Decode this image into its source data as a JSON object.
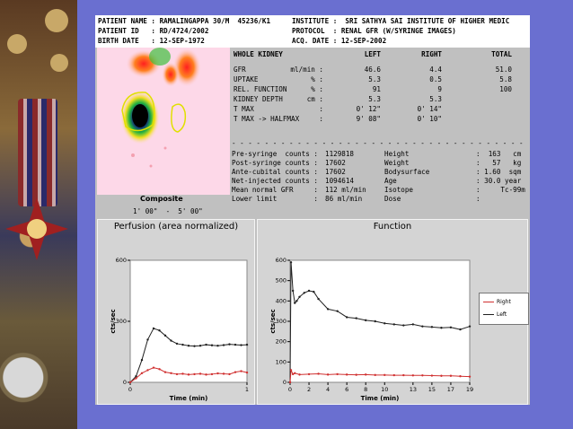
{
  "header": {
    "patient_name": "PATIENT NAME : RAMALINGAPPA 30/M  45236/K1",
    "patient_id": "PATIENT ID   : RD/4724/2002",
    "birth_date": "BIRTH DATE   : 12-SEP-1972",
    "institute": "INSTITUTE :  SRI SATHYA SAI INSTITUTE OF HIGHER MEDIC",
    "protocol": "PROTOCOL  : RENAL GFR (W/SYRINGE IMAGES)",
    "acq_date": "ACQ. DATE : 12-SEP-2002"
  },
  "composite": {
    "title": "Composite",
    "time_range": "1' 00\"  -  5' 00\""
  },
  "kidney_table": {
    "headers": [
      "WHOLE KIDNEY",
      "LEFT",
      "RIGHT",
      "TOTAL"
    ],
    "rows": [
      {
        "label": "GFR",
        "unit": "ml/min :",
        "left": "46.6",
        "right": "4.4",
        "total": "51.0"
      },
      {
        "label": "UPTAKE",
        "unit": "% :",
        "left": "5.3",
        "right": "0.5",
        "total": "5.8"
      },
      {
        "label": "REL. FUNCTION",
        "unit": "% :",
        "left": "91",
        "right": "9",
        "total": "100"
      },
      {
        "label": "KIDNEY DEPTH",
        "unit": "cm :",
        "left": "5.3",
        "right": "5.3",
        "total": ""
      },
      {
        "label": "T MAX",
        "unit": ":",
        "left": "0' 12\"",
        "right": "0' 14\"",
        "total": ""
      },
      {
        "label": "T MAX -> HALFMAX",
        "unit": ":",
        "left": "9' 08\"",
        "right": "0' 10\"",
        "total": ""
      }
    ]
  },
  "counts": [
    {
      "label": "Pre-syringe  counts :",
      "value": "1129818"
    },
    {
      "label": "Post-syringe counts :",
      "value": "17602"
    },
    {
      "label": "Ante-cubital counts :",
      "value": "17602"
    },
    {
      "label": "Net-injected counts :",
      "value": "1094614"
    },
    {
      "label": "Mean normal GFR     :",
      "value": "112 ml/min"
    },
    {
      "label": "Lower limit         :",
      "value": "86 ml/min"
    }
  ],
  "patient_stats": [
    {
      "label": "Height",
      "value": ":  163   cm"
    },
    {
      "label": "Weight",
      "value": ":   57   kg"
    },
    {
      "label": "Bodysurface",
      "value": ": 1.60  sqm"
    },
    {
      "label": "Age",
      "value": ": 30.0 year"
    },
    {
      "label": "Isotope",
      "value": ":     Tc-99m"
    },
    {
      "label": "Dose",
      "value": ":"
    }
  ],
  "perfusion_chart": {
    "title": "Perfusion (area normalized)",
    "ylabel": "cts/sec",
    "xlabel": "Time (min)",
    "yticks": [
      "600",
      "300",
      "0"
    ],
    "xticks": [
      "0",
      "1"
    ],
    "color": "#d03030"
  },
  "function_chart": {
    "title": "Function",
    "ylabel": "cts/sec",
    "xlabel": "Time (min)",
    "yticks": [
      "600",
      "500",
      "400",
      "300",
      "200",
      "100",
      "0"
    ],
    "xticks": [
      "0",
      "2",
      "4",
      "6",
      "8",
      "10",
      "13",
      "15",
      "17",
      "19"
    ],
    "legend": [
      {
        "name": "Right",
        "color": "#d03030"
      },
      {
        "name": "Left",
        "color": "#202020"
      }
    ]
  },
  "chart_data": [
    {
      "type": "line",
      "title": "Perfusion (area normalized)",
      "xlabel": "Time (min)",
      "ylabel": "cts/sec",
      "xlim": [
        0,
        1
      ],
      "ylim": [
        0,
        600
      ],
      "series": [
        {
          "color": "#202020",
          "x": [
            0,
            0.05,
            0.1,
            0.15,
            0.2,
            0.25,
            0.3,
            0.35,
            0.4,
            0.45,
            0.5,
            0.55,
            0.6,
            0.65,
            0.7,
            0.75,
            0.8,
            0.85,
            0.9,
            0.95,
            1.0
          ],
          "y": [
            0,
            30,
            110,
            210,
            265,
            255,
            230,
            205,
            190,
            185,
            180,
            178,
            180,
            185,
            182,
            180,
            183,
            187,
            185,
            183,
            185
          ]
        },
        {
          "color": "#d03030",
          "x": [
            0,
            0.05,
            0.1,
            0.15,
            0.2,
            0.25,
            0.3,
            0.35,
            0.4,
            0.45,
            0.5,
            0.55,
            0.6,
            0.65,
            0.7,
            0.75,
            0.8,
            0.85,
            0.9,
            0.95,
            1.0
          ],
          "y": [
            0,
            20,
            45,
            60,
            72,
            65,
            50,
            45,
            40,
            42,
            38,
            40,
            42,
            38,
            40,
            44,
            42,
            40,
            50,
            55,
            48
          ]
        }
      ]
    },
    {
      "type": "line",
      "title": "Function",
      "xlabel": "Time (min)",
      "ylabel": "cts/sec",
      "xlim": [
        0,
        19
      ],
      "ylim": [
        0,
        600
      ],
      "series": [
        {
          "name": "Left",
          "color": "#202020",
          "x": [
            0,
            0.1,
            0.3,
            0.5,
            0.7,
            1.0,
            1.5,
            2.0,
            2.5,
            3.0,
            4.0,
            5.0,
            6.0,
            7.0,
            8.0,
            9.0,
            10.0,
            11.0,
            12.0,
            13.0,
            14.0,
            15.0,
            16.0,
            17.0,
            18.0,
            19.0
          ],
          "y": [
            0,
            590,
            450,
            390,
            400,
            420,
            440,
            450,
            445,
            410,
            360,
            350,
            320,
            315,
            305,
            300,
            290,
            285,
            280,
            285,
            275,
            272,
            268,
            270,
            260,
            275
          ]
        },
        {
          "name": "Right",
          "color": "#d03030",
          "x": [
            0,
            0.1,
            0.3,
            0.5,
            1.0,
            2.0,
            3.0,
            4.0,
            5.0,
            6.0,
            7.0,
            8.0,
            9.0,
            10.0,
            11.0,
            12.0,
            13.0,
            14.0,
            15.0,
            16.0,
            17.0,
            18.0,
            19.0
          ],
          "y": [
            0,
            60,
            40,
            45,
            38,
            40,
            42,
            38,
            40,
            38,
            37,
            38,
            36,
            36,
            35,
            35,
            34,
            34,
            33,
            32,
            32,
            30,
            28
          ]
        }
      ]
    }
  ]
}
